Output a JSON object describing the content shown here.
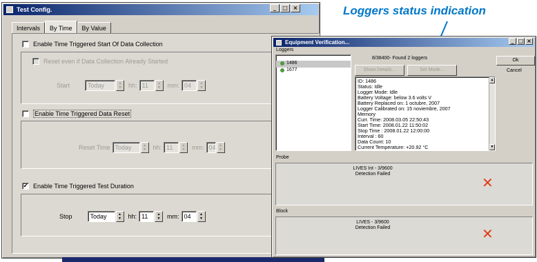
{
  "test_config": {
    "title": "Test Config.",
    "tabs": [
      "Intervals",
      "By Time",
      "By Value"
    ],
    "collection": {
      "enable_label": "Enable Time Triggered Start Of Data Collection",
      "reset_label": "Reset even if Data Collection Already Started",
      "start_label": "Start",
      "day": "Today",
      "hh_label": "hh:",
      "hh": "11",
      "mm_label": "mm:",
      "mm": "04"
    },
    "reset": {
      "enable_label": "Enable Time Triggered Data Reset",
      "time_label": "Reset Time",
      "day": "Today",
      "hh_label": "hh:",
      "hh": "11",
      "mm_label": "mm:",
      "mm": "04"
    },
    "duration": {
      "enable_label": "Enable Time Triggered Test Duration",
      "checked_mark": "✔",
      "stop_label": "Stop",
      "day": "Today",
      "hh_label": "hh:",
      "hh": "11",
      "mm_label": "mm:",
      "mm": "04"
    }
  },
  "equipment": {
    "title": "Equipment Verification...",
    "loggers_label": "Loggers",
    "loggers": [
      "1486",
      "1677"
    ],
    "found_text": "8/38400- Found 2 loggers",
    "show_details": "Show Details...",
    "set_mode": "Set Mode...",
    "ok": "Ok",
    "cancel": "Cancel",
    "info_lines": [
      "ID: 1486",
      "Status: Idle",
      "Logger Mode: Idle",
      "Battery Voltage: below 3.6 volts V",
      "Battery Replaced on: 1 octubre, 2007",
      "Logger Calibrated on: 15 noviembre, 2007",
      "Memory",
      "Curr. Time: 2008.03.05 22:50:43",
      "Start Time: 2008.01.22 11:50:02",
      "Stop Time : 2008.01.22 12:00:00",
      "Interval : 60",
      "Data Count: 10",
      "Current Temperature: +20.92 °C"
    ],
    "probe": {
      "label": "Probe",
      "line1": "LIVES Int - 3/9600",
      "line2": "Detection Failed"
    },
    "block": {
      "label": "Block",
      "line1": "LIVES - 3/9600",
      "line2": "Detection Failed"
    }
  },
  "annotation": "Loggers status indication",
  "colors": {
    "annotation": "#0077c8",
    "failure": "#e03c1a",
    "title_bar": "#0a246a"
  },
  "icons": {
    "cross": "✕"
  }
}
